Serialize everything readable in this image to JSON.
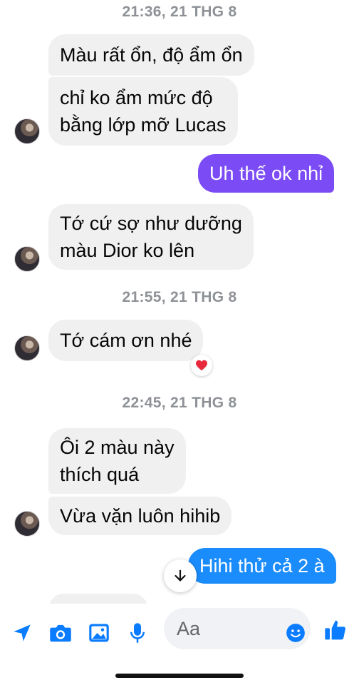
{
  "colors": {
    "incoming_bubble": "#f0f0f1",
    "outgoing_purple": "#7b4cf5",
    "outgoing_blue": "#1b8cfb",
    "messenger_blue": "#0a7cff",
    "timestamp": "#8e9196"
  },
  "timestamps": {
    "t1": "21:36, 21 THG 8",
    "t2": "21:55, 21 THG 8",
    "t3": "22:45, 21 THG 8"
  },
  "messages": {
    "m1": "Màu rất ổn, độ ẩm ổn",
    "m2_line1": "chỉ ko ẩm mức độ",
    "m2_line2": "bằng lớp mỡ Lucas",
    "m3": "Uh thế ok nhỉ",
    "m4_line1": "Tớ cứ sợ như dưỡng",
    "m4_line2": "màu Dior ko lên",
    "m5": "Tớ cám ơn nhé",
    "m6_line1": "Ôi 2 màu này",
    "m6_line2": "thích quá",
    "m7": "Vừa vặn luôn hihib",
    "m8": "Hihi thử cả 2 à"
  },
  "reaction_icon": "heart-icon",
  "composer": {
    "placeholder": "Aa",
    "icons": [
      "location-arrow-icon",
      "camera-icon",
      "image-icon",
      "microphone-icon",
      "emoji-icon",
      "like-icon"
    ]
  },
  "scroll_icon": "arrow-down-icon"
}
